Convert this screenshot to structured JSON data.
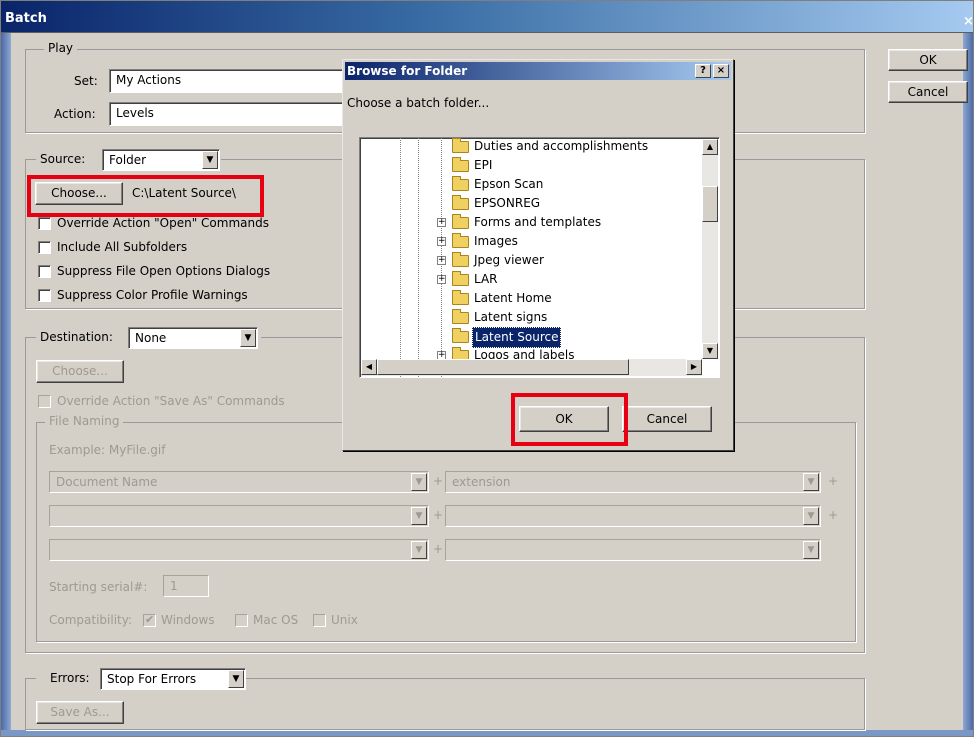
{
  "window": {
    "title": "Batch",
    "close_glyph": "×"
  },
  "side_buttons": {
    "ok": "OK",
    "cancel": "Cancel"
  },
  "play": {
    "legend": "Play",
    "set_label": "Set:",
    "set_value": "My Actions",
    "action_label": "Action:",
    "action_value": "Levels"
  },
  "source": {
    "label": "Source:",
    "value": "Folder",
    "choose_button": "Choose...",
    "path": "C:\\Latent Source\\",
    "options": [
      "Override Action \"Open\" Commands",
      "Include All Subfolders",
      "Suppress File Open Options Dialogs",
      "Suppress Color Profile Warnings"
    ]
  },
  "destination": {
    "label": "Destination:",
    "value": "None",
    "choose_button": "Choose...",
    "override_label": "Override Action \"Save As\" Commands",
    "file_naming": {
      "legend": "File Naming",
      "example": "Example: MyFile.gif",
      "row1_left": "Document Name",
      "row1_right": "extension",
      "plus": "+",
      "starting_serial_label": "Starting serial#:",
      "starting_serial_value": "1",
      "compatibility_label": "Compatibility:",
      "compat_windows": "Windows",
      "compat_mac": "Mac OS",
      "compat_unix": "Unix"
    }
  },
  "errors": {
    "label": "Errors:",
    "value": "Stop For Errors",
    "save_as_button": "Save As..."
  },
  "browse_dialog": {
    "title": "Browse for Folder",
    "help_glyph": "?",
    "close_glyph": "×",
    "prompt": "Choose a batch folder...",
    "folders": [
      {
        "name": "Duties and accomplishments",
        "expandable": false,
        "selected": false
      },
      {
        "name": "EPI",
        "expandable": false,
        "selected": false
      },
      {
        "name": "Epson Scan",
        "expandable": false,
        "selected": false
      },
      {
        "name": "EPSONREG",
        "expandable": false,
        "selected": false
      },
      {
        "name": "Forms and templates",
        "expandable": true,
        "selected": false
      },
      {
        "name": "Images",
        "expandable": true,
        "selected": false
      },
      {
        "name": "Jpeg viewer",
        "expandable": true,
        "selected": false
      },
      {
        "name": "LAR",
        "expandable": true,
        "selected": false
      },
      {
        "name": "Latent Home",
        "expandable": false,
        "selected": false
      },
      {
        "name": "Latent signs",
        "expandable": false,
        "selected": false
      },
      {
        "name": "Latent Source",
        "expandable": false,
        "selected": true
      },
      {
        "name": "Logos and labels",
        "expandable": true,
        "selected": false
      }
    ],
    "ok_button": "OK",
    "cancel_button": "Cancel"
  },
  "colors": {
    "highlight": "#e60012",
    "dialog_bg": "#d4d0c8",
    "selection": "#0a246a"
  }
}
